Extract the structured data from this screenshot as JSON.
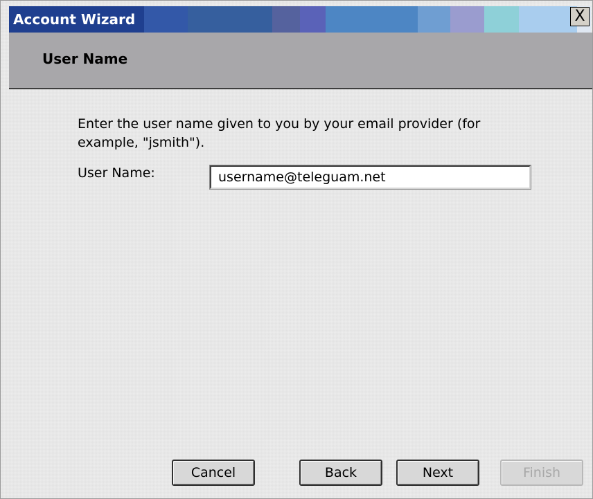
{
  "window": {
    "title": "Account Wizard",
    "close_label": "X"
  },
  "page": {
    "header_title": "User Name",
    "instructions": "Enter the user name given to you by your email provider (for example, \"jsmith\").",
    "username_label": "User Name:",
    "username_value": "username@teleguam.net"
  },
  "buttons": {
    "cancel": "Cancel",
    "back": "Back",
    "next": "Next",
    "finish": "Finish",
    "finish_enabled": false
  },
  "colors": {
    "title_bar_start": "#1f3f8f",
    "header_band": "#a8a7aa",
    "dialog_background": "#ececec",
    "disabled_text": "#a8a8a8"
  },
  "icons": {
    "close": "close-icon"
  }
}
